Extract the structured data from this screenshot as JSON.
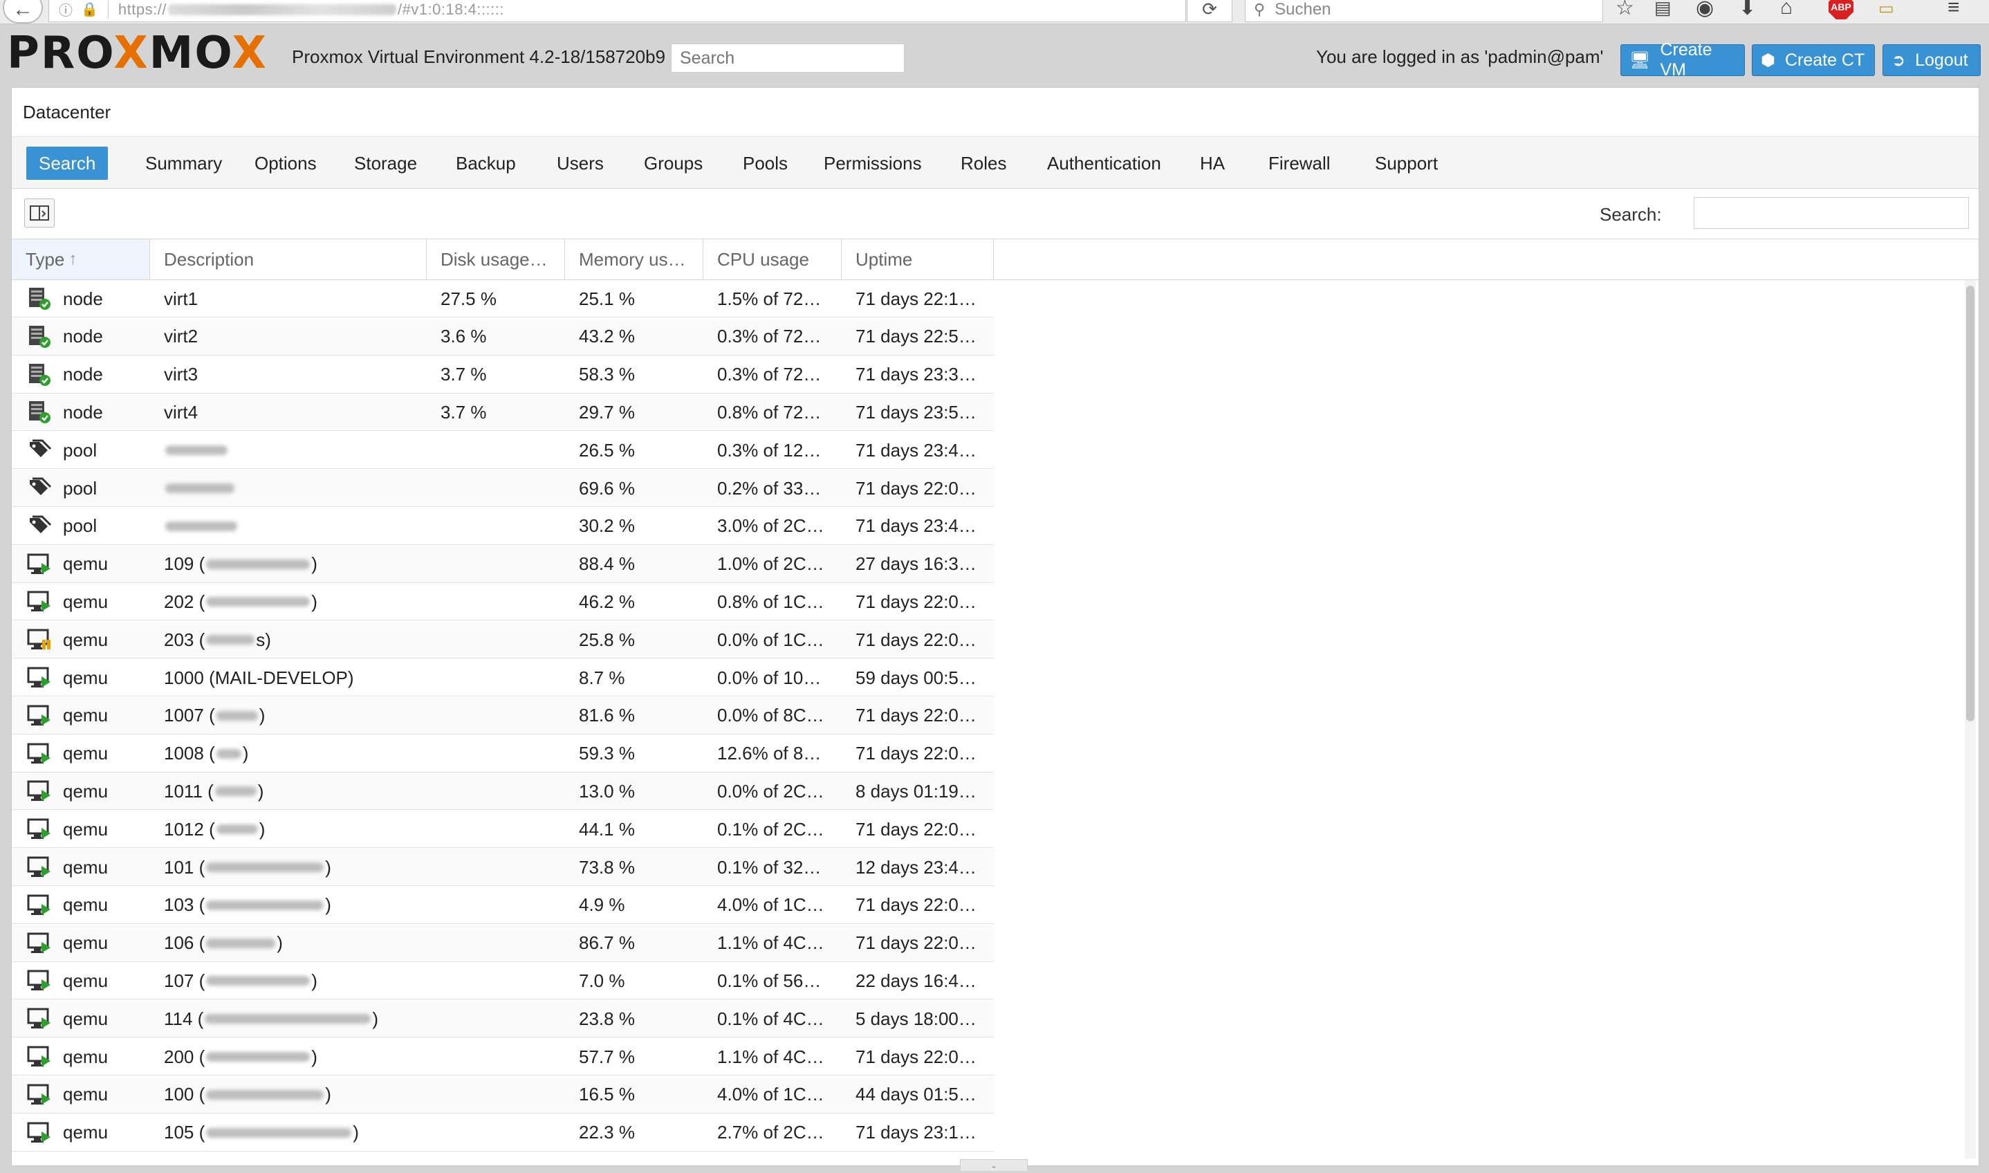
{
  "browser": {
    "url_prefix": "https://",
    "url_suffix": "/#v1:0:18:4::::::",
    "search_placeholder": "Suchen",
    "adblock_label": "ABP"
  },
  "header": {
    "logo_parts": [
      "PRO",
      "X",
      "MO",
      "X"
    ],
    "version": "Proxmox Virtual Environment 4.2-18/158720b9",
    "search_placeholder": "Search",
    "logged_in": "You are logged in as 'padmin@pam'",
    "create_vm": "Create VM",
    "create_ct": "Create CT",
    "logout": "Logout"
  },
  "panel": {
    "title": "Datacenter",
    "tabs": [
      "Search",
      "Summary",
      "Options",
      "Storage",
      "Backup",
      "Users",
      "Groups",
      "Pools",
      "Permissions",
      "Roles",
      "Authentication",
      "HA",
      "Firewall",
      "Support"
    ],
    "active_tab": 0,
    "search_label": "Search:"
  },
  "grid": {
    "columns": [
      "Type",
      "Description",
      "Disk usage…",
      "Memory us…",
      "CPU usage",
      "Uptime"
    ],
    "sort_column": "Type",
    "sort_direction": "ascending",
    "rows": [
      {
        "icon": "node-online",
        "type": "node",
        "desc": "virt1",
        "blur": 0,
        "disk": "27.5 %",
        "mem": "25.1 %",
        "cpu": "1.5% of 72…",
        "uptime": "71 days 22:1…"
      },
      {
        "icon": "node-online",
        "type": "node",
        "desc": "virt2",
        "blur": 0,
        "disk": "3.6 %",
        "mem": "43.2 %",
        "cpu": "0.3% of 72…",
        "uptime": "71 days 22:5…"
      },
      {
        "icon": "node-online",
        "type": "node",
        "desc": "virt3",
        "blur": 0,
        "disk": "3.7 %",
        "mem": "58.3 %",
        "cpu": "0.3% of 72…",
        "uptime": "71 days 23:3…"
      },
      {
        "icon": "node-online",
        "type": "node",
        "desc": "virt4",
        "blur": 0,
        "disk": "3.7 %",
        "mem": "29.7 %",
        "cpu": "0.8% of 72…",
        "uptime": "71 days 23:5…"
      },
      {
        "icon": "pool",
        "type": "pool",
        "desc": "",
        "blur": 90,
        "disk": "",
        "mem": "26.5 %",
        "cpu": "0.3% of 12…",
        "uptime": "71 days 23:4…"
      },
      {
        "icon": "pool",
        "type": "pool",
        "desc": "",
        "blur": 100,
        "disk": "",
        "mem": "69.6 %",
        "cpu": "0.2% of 33…",
        "uptime": "71 days 22:0…"
      },
      {
        "icon": "pool",
        "type": "pool",
        "desc": "",
        "blur": 104,
        "disk": "",
        "mem": "30.2 %",
        "cpu": "3.0% of 2C…",
        "uptime": "71 days 23:4…"
      },
      {
        "icon": "qemu-running",
        "type": "qemu",
        "desc": "109 (",
        "blur": 150,
        "suffix": ")",
        "disk": "",
        "mem": "88.4 %",
        "cpu": "1.0% of 2C…",
        "uptime": "27 days 16:3…"
      },
      {
        "icon": "qemu-running",
        "type": "qemu",
        "desc": "202 (",
        "blur": 150,
        "suffix": ")",
        "disk": "",
        "mem": "46.2 %",
        "cpu": "0.8% of 1C…",
        "uptime": "71 days 22:0…"
      },
      {
        "icon": "qemu-paused",
        "type": "qemu",
        "desc": "203 (",
        "blur": 70,
        "suffix": "s)",
        "disk": "",
        "mem": "25.8 %",
        "cpu": "0.0% of 1C…",
        "uptime": "71 days 22:0…"
      },
      {
        "icon": "qemu-running",
        "type": "qemu",
        "desc": "1000 (MAIL-DEVELOP)",
        "blur": 0,
        "disk": "",
        "mem": "8.7 %",
        "cpu": "0.0% of 10…",
        "uptime": "59 days 00:5…"
      },
      {
        "icon": "qemu-running",
        "type": "qemu",
        "desc": "1007 (",
        "blur": 60,
        "suffix": ")",
        "disk": "",
        "mem": "81.6 %",
        "cpu": "0.0% of 8C…",
        "uptime": "71 days 22:0…"
      },
      {
        "icon": "qemu-running",
        "type": "qemu",
        "desc": "1008 (",
        "blur": 36,
        "suffix": ")",
        "disk": "",
        "mem": "59.3 %",
        "cpu": "12.6% of 8…",
        "uptime": "71 days 22:0…"
      },
      {
        "icon": "qemu-running",
        "type": "qemu",
        "desc": "1011 (",
        "blur": 60,
        "suffix": ")",
        "disk": "",
        "mem": "13.0 %",
        "cpu": "0.0% of 2C…",
        "uptime": "8 days 01:19…"
      },
      {
        "icon": "qemu-running",
        "type": "qemu",
        "desc": "1012 (",
        "blur": 60,
        "suffix": ")",
        "disk": "",
        "mem": "44.1 %",
        "cpu": "0.1% of 2C…",
        "uptime": "71 days 22:0…"
      },
      {
        "icon": "qemu-running",
        "type": "qemu",
        "desc": "101 (",
        "blur": 170,
        "suffix": ")",
        "disk": "",
        "mem": "73.8 %",
        "cpu": "0.1% of 32…",
        "uptime": "12 days 23:4…"
      },
      {
        "icon": "qemu-running",
        "type": "qemu",
        "desc": "103 (",
        "blur": 170,
        "suffix": ")",
        "disk": "",
        "mem": "4.9 %",
        "cpu": "4.0% of 1C…",
        "uptime": "71 days 22:0…"
      },
      {
        "icon": "qemu-running",
        "type": "qemu",
        "desc": "106 (",
        "blur": 100,
        "suffix": ")",
        "disk": "",
        "mem": "86.7 %",
        "cpu": "1.1% of 4C…",
        "uptime": "71 days 22:0…"
      },
      {
        "icon": "qemu-running",
        "type": "qemu",
        "desc": "107 (",
        "blur": 150,
        "suffix": ")",
        "disk": "",
        "mem": "7.0 %",
        "cpu": "0.1% of 56…",
        "uptime": "22 days 16:4…"
      },
      {
        "icon": "qemu-running",
        "type": "qemu",
        "desc": "114 (",
        "blur": 240,
        "suffix": ")",
        "disk": "",
        "mem": "23.8 %",
        "cpu": "0.1% of 4C…",
        "uptime": "5 days 18:00…"
      },
      {
        "icon": "qemu-running",
        "type": "qemu",
        "desc": "200 (",
        "blur": 150,
        "suffix": ")",
        "disk": "",
        "mem": "57.7 %",
        "cpu": "1.1% of 4C…",
        "uptime": "71 days 22:0…"
      },
      {
        "icon": "qemu-running",
        "type": "qemu",
        "desc": "100 (",
        "blur": 170,
        "suffix": ")",
        "disk": "",
        "mem": "16.5 %",
        "cpu": "4.0% of 1C…",
        "uptime": "44 days 01:5…"
      },
      {
        "icon": "qemu-running",
        "type": "qemu",
        "desc": "105 (",
        "blur": 210,
        "suffix": ")",
        "disk": "",
        "mem": "22.3 %",
        "cpu": "2.7% of 2C…",
        "uptime": "71 days 23:1…"
      }
    ]
  },
  "colors": {
    "accent": "#3892d4",
    "brand_orange": "#e57000",
    "status_green": "#2e9e2e",
    "status_orange": "#e8a000"
  }
}
